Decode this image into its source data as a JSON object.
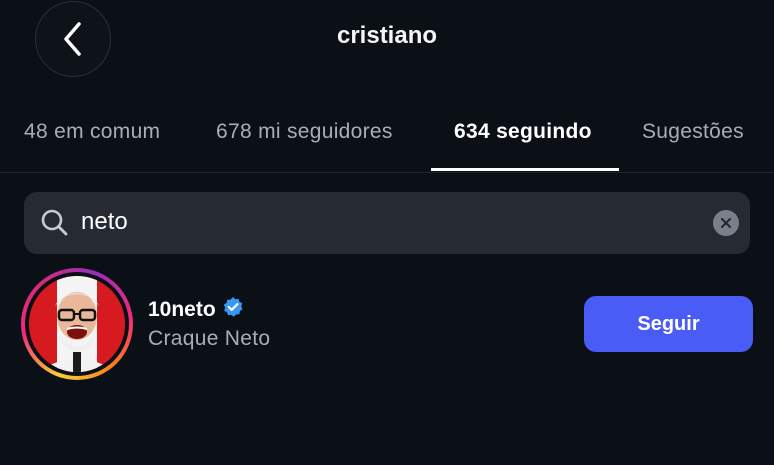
{
  "header": {
    "title": "cristiano",
    "back_icon": "chevron-left-icon"
  },
  "tabs": [
    {
      "label": "48 em comum",
      "active": false
    },
    {
      "label": "678 mi seguidores",
      "active": false
    },
    {
      "label": "634 seguindo",
      "active": true
    },
    {
      "label": "Sugestões",
      "active": false
    }
  ],
  "search": {
    "value": "neto",
    "icon": "search-icon",
    "clear_icon": "clear-icon"
  },
  "results": [
    {
      "username": "10neto",
      "verified": true,
      "full_name": "Craque Neto",
      "button_label": "Seguir"
    }
  ],
  "colors": {
    "background": "#0b0f16",
    "follow_button": "#4a5cf6",
    "verified_badge": "#3897f0",
    "search_field": "#262b33"
  }
}
